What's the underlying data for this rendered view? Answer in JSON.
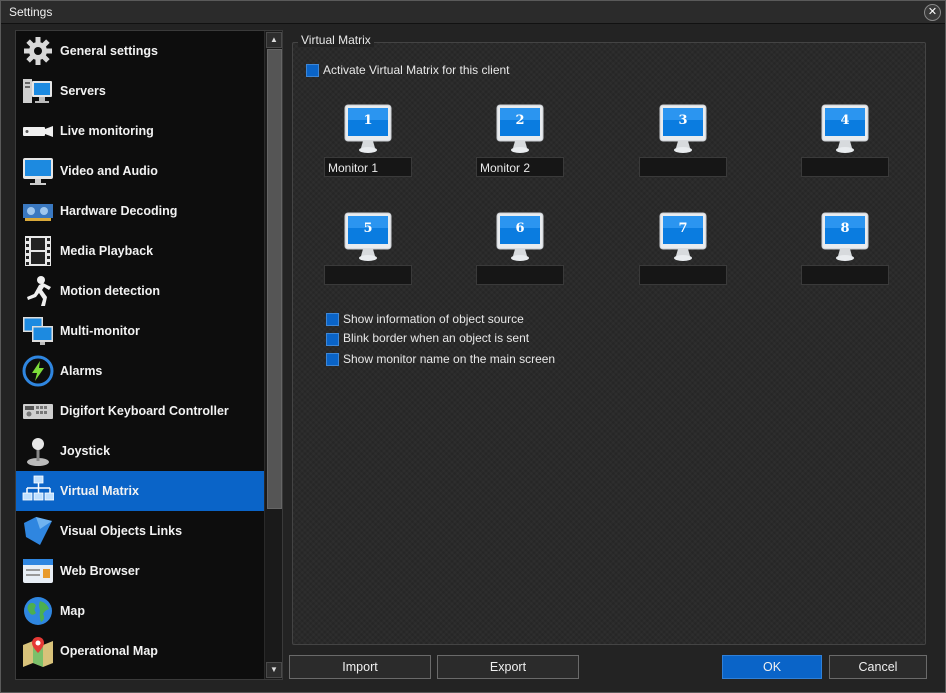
{
  "window": {
    "title": "Settings",
    "close_symbol": "✕"
  },
  "sidebar": {
    "items": [
      {
        "label": "General settings",
        "icon": "gear-icon"
      },
      {
        "label": "Servers",
        "icon": "servers-icon"
      },
      {
        "label": "Live monitoring",
        "icon": "camera-icon"
      },
      {
        "label": "Video and Audio",
        "icon": "display-icon"
      },
      {
        "label": "Hardware Decoding",
        "icon": "gpu-card-icon"
      },
      {
        "label": "Media Playback",
        "icon": "film-strip-icon"
      },
      {
        "label": "Motion detection",
        "icon": "running-figure-icon"
      },
      {
        "label": "Multi-monitor",
        "icon": "multi-monitor-icon"
      },
      {
        "label": "Alarms",
        "icon": "lightning-alarm-icon"
      },
      {
        "label": "Digifort Keyboard Controller",
        "icon": "keyboard-controller-icon"
      },
      {
        "label": "Joystick",
        "icon": "joystick-icon"
      },
      {
        "label": "Virtual Matrix",
        "icon": "network-matrix-icon"
      },
      {
        "label": "Visual Objects Links",
        "icon": "visual-objects-icon"
      },
      {
        "label": "Web Browser",
        "icon": "browser-window-icon"
      },
      {
        "label": "Map",
        "icon": "globe-icon"
      },
      {
        "label": "Operational Map",
        "icon": "map-pin-icon"
      }
    ],
    "active_item": "Virtual Matrix"
  },
  "virtual_matrix": {
    "group_title": "Virtual Matrix",
    "activate_label": "Activate Virtual Matrix for this client",
    "monitors": [
      {
        "number": "1",
        "name": "Monitor 1"
      },
      {
        "number": "2",
        "name": "Monitor 2"
      },
      {
        "number": "3",
        "name": ""
      },
      {
        "number": "4",
        "name": ""
      },
      {
        "number": "5",
        "name": ""
      },
      {
        "number": "6",
        "name": ""
      },
      {
        "number": "7",
        "name": ""
      },
      {
        "number": "8",
        "name": ""
      }
    ],
    "options": [
      "Show information of object source",
      "Blink border when an object is sent",
      "Show monitor name on the main screen"
    ]
  },
  "buttons": {
    "import": "Import",
    "export": "Export",
    "ok": "OK",
    "cancel": "Cancel"
  },
  "colors": {
    "accent": "#0a64c8",
    "background": "#232323",
    "sidebar": "#0d0d0d"
  }
}
